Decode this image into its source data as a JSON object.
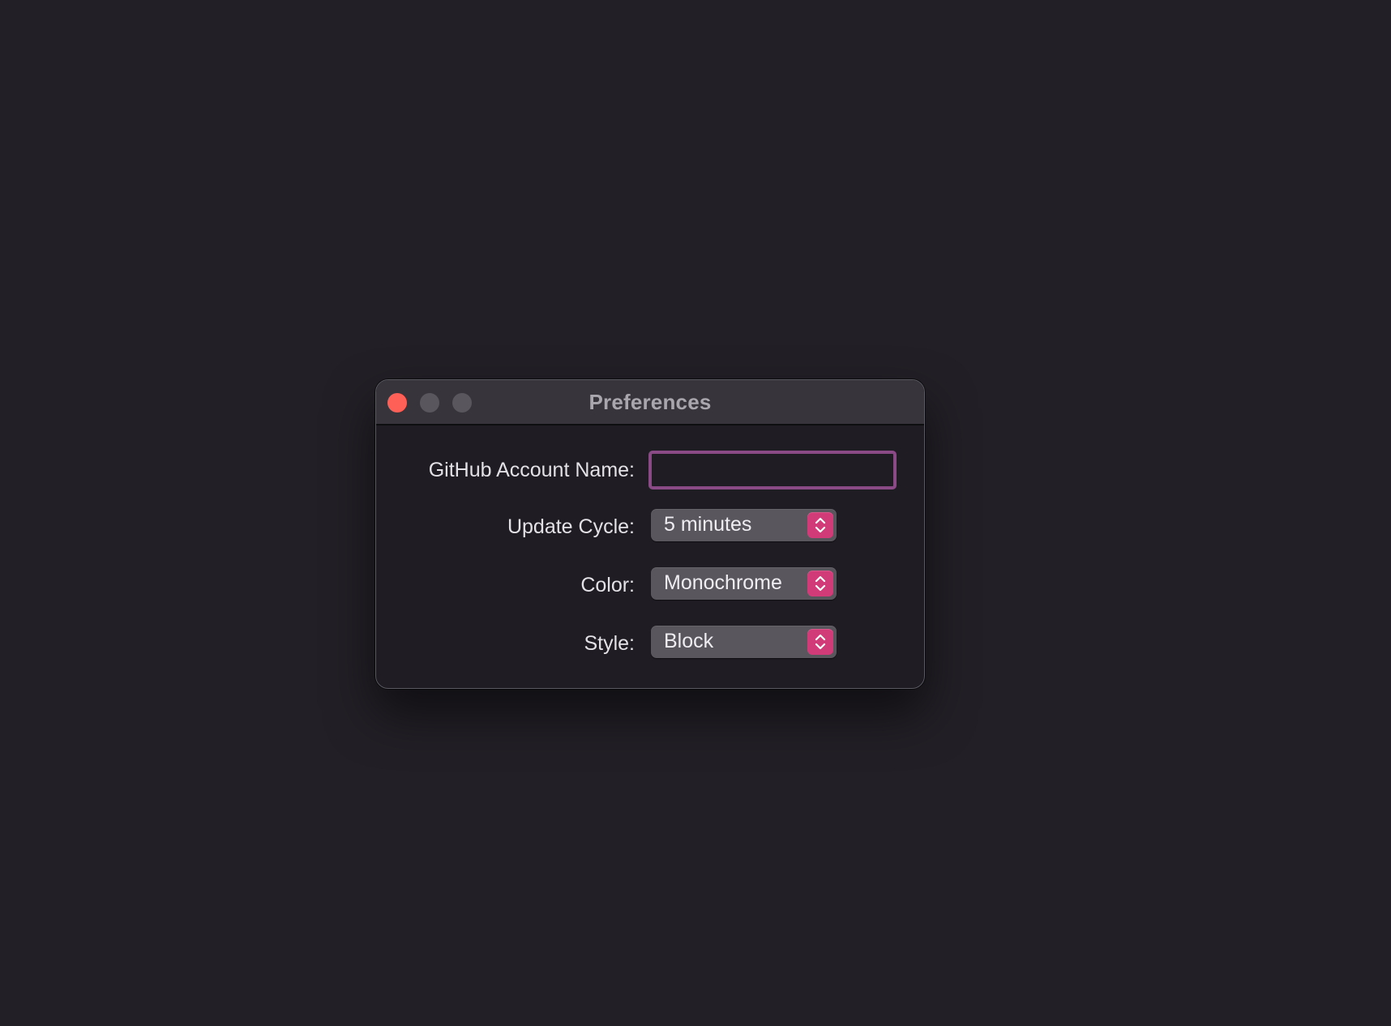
{
  "window": {
    "title": "Preferences"
  },
  "form": {
    "account": {
      "label": "GitHub Account Name:",
      "value": "",
      "placeholder": ""
    },
    "update_cycle": {
      "label": "Update Cycle:",
      "value": "5 minutes"
    },
    "color": {
      "label": "Color:",
      "value": "Monochrome"
    },
    "style": {
      "label": "Style:",
      "value": "Block"
    }
  },
  "colors": {
    "accent": "#d13c78",
    "focus_ring": "#8a4a85",
    "close_button": "#fe5f57",
    "window_background": "#1f1c23",
    "desktop_background": "#221f26"
  },
  "icons": {
    "stepper": "chevron-up-down-icon"
  }
}
